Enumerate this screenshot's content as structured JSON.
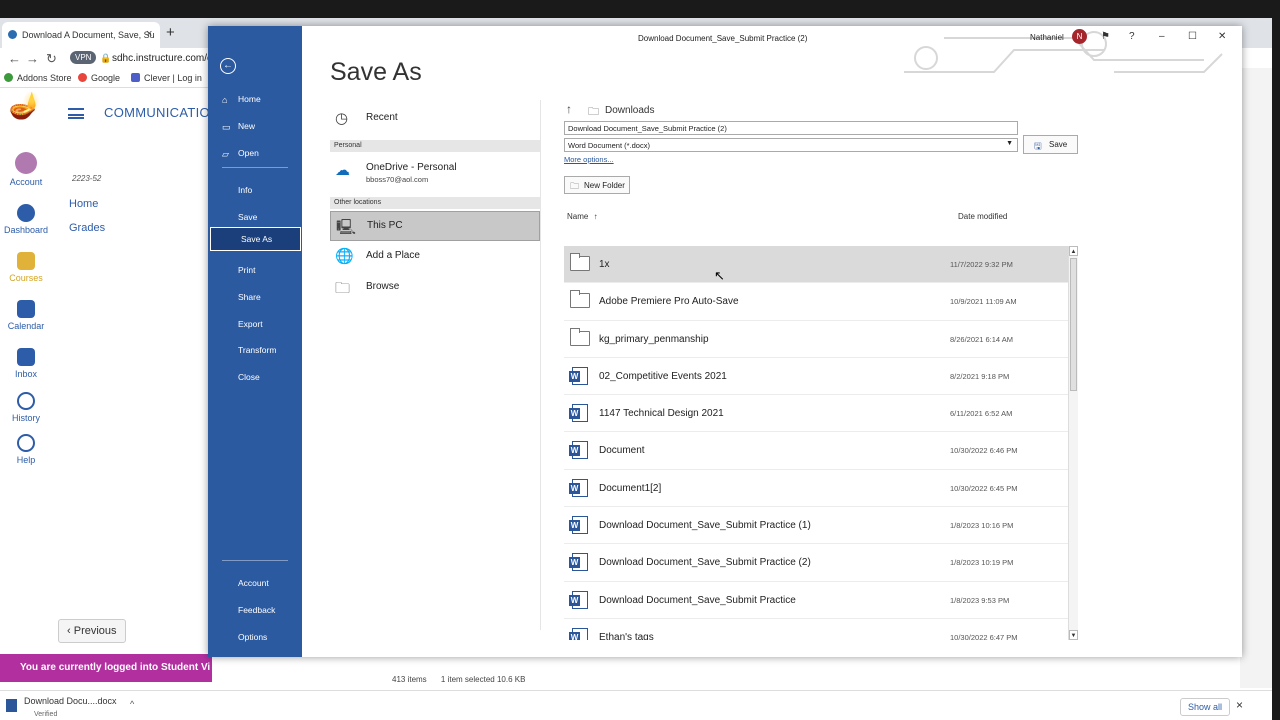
{
  "browser": {
    "tab_title": "Download A Document, Save, Su",
    "tab_close": "×",
    "new_tab": "+",
    "vpn_label": "VPN",
    "url": "sdhc.instructure.com/c",
    "bookmarks": [
      "Addons Store",
      "Google",
      "Clever | Log in"
    ]
  },
  "canvas": {
    "nav": [
      "Account",
      "Dashboard",
      "Courses",
      "Calendar",
      "Inbox",
      "History",
      "Help"
    ],
    "course_title": "COMMUNICATION",
    "course_code": "2223-52",
    "course_links": [
      "Home",
      "Grades"
    ],
    "previous_button": "Previous",
    "student_banner": "You are currently logged into Student Vi"
  },
  "downloads": {
    "file_name": "Download Docu....docx",
    "file_status": "Verified",
    "show_all": "Show all"
  },
  "explorer_status": {
    "item_count": "413 items",
    "selection": "1 item selected  10.6 KB"
  },
  "word": {
    "window_title": "Download Document_Save_Submit Practice (2)",
    "user_name": "Nathaniel",
    "user_initial": "N",
    "help": "?",
    "backstage": {
      "top_items": [
        "Home",
        "New",
        "Open"
      ],
      "mid_items": [
        "Info",
        "Save",
        "Save As",
        "Print",
        "Share",
        "Export",
        "Transform",
        "Close"
      ],
      "bottom_items": [
        "Account",
        "Feedback",
        "Options"
      ],
      "active": "Save As"
    },
    "page_title": "Save As",
    "locations": {
      "recent": "Recent",
      "personal_header": "Personal",
      "onedrive_label": "OneDrive - Personal",
      "onedrive_email": "bboss70@aol.com",
      "other_header": "Other locations",
      "this_pc": "This PC",
      "add_place": "Add a Place",
      "browse": "Browse"
    },
    "save_panel": {
      "current_folder": "Downloads",
      "file_name_value": "Download Document_Save_Submit Practice (2)",
      "file_type_value": "Word Document (*.docx)",
      "more_options": "More options...",
      "save_button": "Save",
      "new_folder_button": "New Folder",
      "col_name": "Name",
      "col_date": "Date modified",
      "files": [
        {
          "name": "1x",
          "date": "11/7/2022 9:32 PM",
          "kind": "folder",
          "selected": true
        },
        {
          "name": "Adobe Premiere Pro Auto-Save",
          "date": "10/9/2021 11:09 AM",
          "kind": "folder"
        },
        {
          "name": "kg_primary_penmanship",
          "date": "8/26/2021 6:14 AM",
          "kind": "folder"
        },
        {
          "name": "02_Competitive Events 2021",
          "date": "8/2/2021 9:18 PM",
          "kind": "doc"
        },
        {
          "name": "1147 Technical Design 2021",
          "date": "6/11/2021 6:52 AM",
          "kind": "doc"
        },
        {
          "name": "Document",
          "date": "10/30/2022 6:46 PM",
          "kind": "doc"
        },
        {
          "name": "Document1[2]",
          "date": "10/30/2022 6:45 PM",
          "kind": "doc"
        },
        {
          "name": "Download Document_Save_Submit Practice (1)",
          "date": "1/8/2023 10:16 PM",
          "kind": "doc"
        },
        {
          "name": "Download Document_Save_Submit Practice (2)",
          "date": "1/8/2023 10:19 PM",
          "kind": "doc"
        },
        {
          "name": "Download Document_Save_Submit Practice",
          "date": "1/8/2023 9:53 PM",
          "kind": "doc"
        },
        {
          "name": "Ethan's tags",
          "date": "10/30/2022 6:47 PM",
          "kind": "doc"
        }
      ]
    }
  }
}
